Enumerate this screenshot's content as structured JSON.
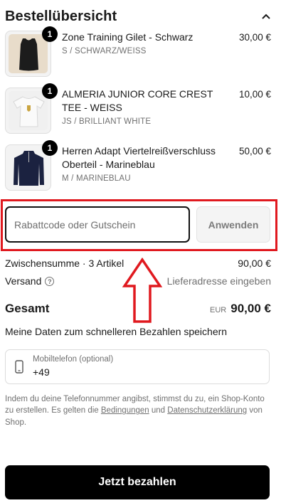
{
  "header": {
    "title": "Bestellübersicht",
    "toggle_icon": "chevron-up-icon"
  },
  "items": [
    {
      "title": "Zone Training Gilet - Schwarz",
      "variant": "S / SCHWARZ/WEISS",
      "price": "30,00 €",
      "quantity": "1",
      "thumb_color": "#1c1c1c"
    },
    {
      "title": "ALMERIA JUNIOR CORE CREST TEE - WEISS",
      "variant": "JS / BRILLIANT WHITE",
      "price": "10,00 €",
      "quantity": "1",
      "thumb_color": "#f7f7f7"
    },
    {
      "title": "Herren Adapt Viertelreißverschluss Oberteil - Marineblau",
      "variant": "M / MARINEBLAU",
      "price": "50,00 €",
      "quantity": "1",
      "thumb_color": "#1b2240"
    }
  ],
  "discount": {
    "placeholder": "Rabattcode oder Gutschein",
    "apply_label": "Anwenden"
  },
  "summary": {
    "subtotal_label": "Zwischensumme · 3 Artikel",
    "subtotal_value": "90,00 €",
    "shipping_label": "Versand",
    "shipping_value": "Lieferadresse eingeben",
    "total_label": "Gesamt",
    "currency": "EUR",
    "total_value": "90,00 €"
  },
  "save_info": {
    "heading": "Meine Daten zum schnelleren Bezahlen speichern",
    "phone_label": "Mobiltelefon (optional)",
    "phone_value": "+49"
  },
  "legal": {
    "text_1": "Indem du deine Telefonnummer angibst, stimmst du zu, ein Shop-Konto zu erstellen. Es gelten die ",
    "terms_link": "Bedingungen",
    "text_2": " und ",
    "privacy_link": "Datenschutzerklärung",
    "text_3": " von Shop."
  },
  "pay_button": {
    "label": "Jetzt bezahlen"
  },
  "colors": {
    "highlight": "#e0191f",
    "primary": "#000000",
    "muted": "#707070"
  }
}
